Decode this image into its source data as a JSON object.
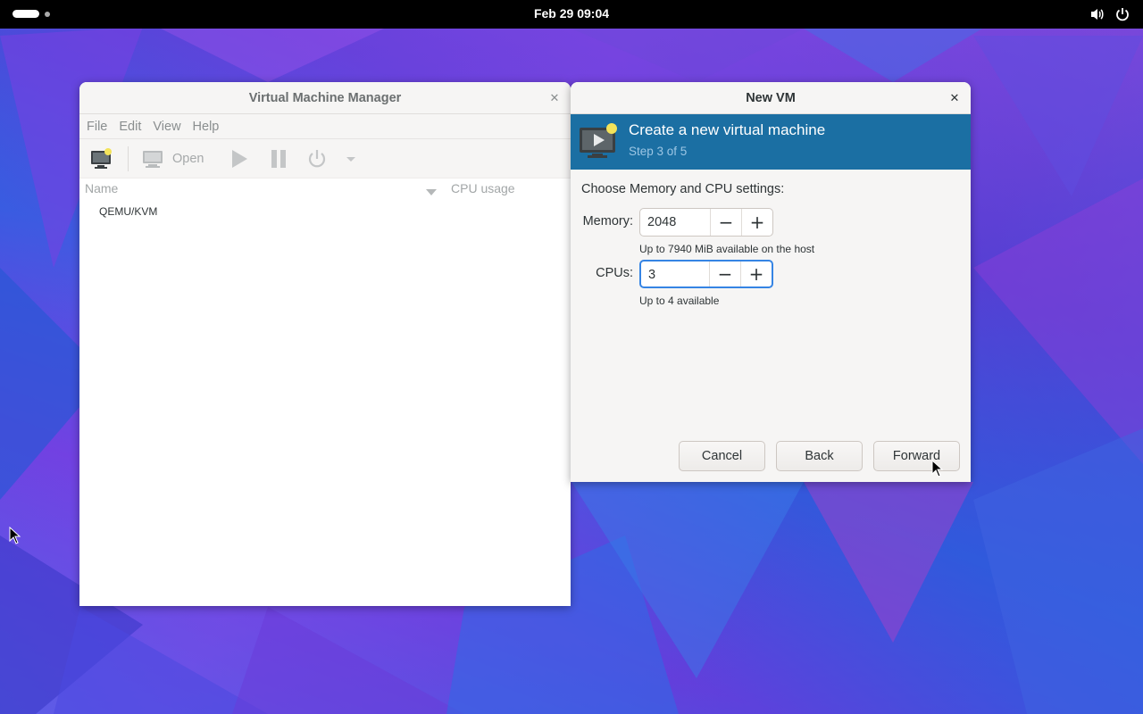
{
  "topbar": {
    "clock": "Feb 29  09:04",
    "icons": [
      "volume-icon",
      "power-icon"
    ]
  },
  "vmm": {
    "title": "Virtual Machine Manager",
    "menu": [
      "File",
      "Edit",
      "View",
      "Help"
    ],
    "toolbar": {
      "open_label": "Open"
    },
    "columns": {
      "name": "Name",
      "cpu": "CPU usage"
    },
    "connections": [
      "QEMU/KVM"
    ]
  },
  "newvm": {
    "title": "New VM",
    "heading": "Create a new virtual machine",
    "step": "Step 3 of 5",
    "intro": "Choose Memory and CPU settings:",
    "memory": {
      "label": "Memory:",
      "value": "2048",
      "hint": "Up to 7940 MiB available on the host"
    },
    "cpus": {
      "label": "CPUs:",
      "value": "3",
      "hint": "Up to 4 available"
    },
    "buttons": {
      "cancel": "Cancel",
      "back": "Back",
      "forward": "Forward"
    }
  },
  "colors": {
    "banner": "#1b6fa3",
    "focus": "#3584e4",
    "topbar": "#000000"
  }
}
